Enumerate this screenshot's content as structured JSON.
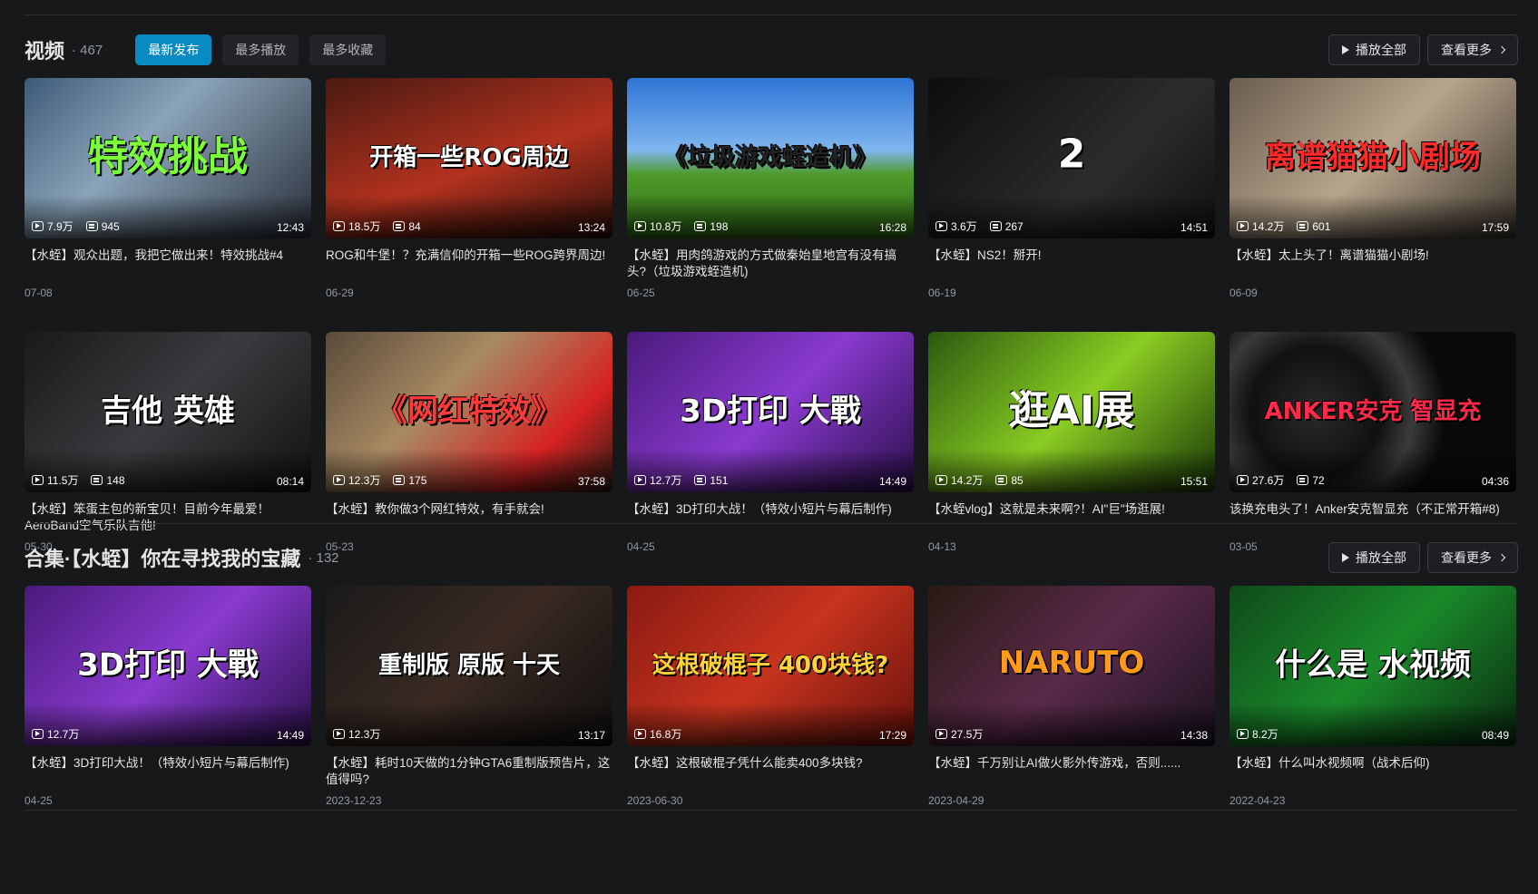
{
  "videos_section": {
    "title": "视频",
    "count": "· 467",
    "tabs": [
      "最新发布",
      "最多播放",
      "最多收藏"
    ],
    "play_all": "播放全部",
    "see_more": "查看更多",
    "items": [
      {
        "thumb_text": "特效挑战",
        "bg": "linear-gradient(135deg,#3d5a78,#8aa3b8 40%,#2a2f3a)",
        "txt_color": "#7cff3a",
        "views": "7.9万",
        "danmaku": "945",
        "duration": "12:43",
        "title": "【水蛭】观众出题，我把它做出来！特效挑战#4",
        "date": "07-08"
      },
      {
        "thumb_text": "开箱一些ROG周边",
        "bg": "linear-gradient(160deg,#4a1a12,#b3321e 55%,#2b0f0a)",
        "txt_color": "#ffffff",
        "views": "18.5万",
        "danmaku": "84",
        "duration": "13:24",
        "title": "ROG和牛堡！？充满信仰的开箱一些ROG跨界周边!",
        "date": "06-29"
      },
      {
        "thumb_text": "《垃圾游戏蛭造机》",
        "bg": "linear-gradient(180deg,#2e74d6,#7fb6ee 45%,#4f9a2a 60%,#2f6e16)",
        "txt_color": "#222222",
        "views": "10.8万",
        "danmaku": "198",
        "duration": "16:28",
        "title": "【水蛭】用肉鸽游戏的方式做秦始皇地宫有没有搞头?（垃圾游戏蛭造机)",
        "date": "06-25"
      },
      {
        "thumb_text": "2",
        "bg": "linear-gradient(135deg,#0d0d0e,#2b2c2e 60%,#111)",
        "txt_color": "#ffffff",
        "views": "3.6万",
        "danmaku": "267",
        "duration": "14:51",
        "title": "【水蛭】NS2！掰开!",
        "date": "06-19"
      },
      {
        "thumb_text": "离谱猫猫小剧场",
        "bg": "linear-gradient(135deg,#6a5d4e,#b7a58c 50%,#3a342c)",
        "txt_color": "#ff2a2a",
        "views": "14.2万",
        "danmaku": "601",
        "duration": "17:59",
        "title": "【水蛭】太上头了！离谱猫猫小剧场!",
        "date": "06-09"
      },
      {
        "thumb_text": "吉他 英雄",
        "bg": "linear-gradient(135deg,#1a1a1c,#3b3b3f 50%,#121213)",
        "txt_color": "#ffffff",
        "views": "11.5万",
        "danmaku": "148",
        "duration": "08:14",
        "title": "【水蛭】笨蛋主包的新宝贝！目前今年最爱！AeroBand空气乐队吉他!",
        "date": "05-30"
      },
      {
        "thumb_text": "《网红特效》",
        "bg": "linear-gradient(135deg,#5a4a3a,#a88a62 40%,#d62222 75%,#2a1c14)",
        "txt_color": "#ff3a3a",
        "views": "12.3万",
        "danmaku": "175",
        "duration": "37:58",
        "title": "【水蛭】教你做3个网红特效，有手就会!",
        "date": "05-23"
      },
      {
        "thumb_text": "3D打印 大戰",
        "bg": "linear-gradient(135deg,#4a1a7a,#8a3ad0 50%,#2a0f4a)",
        "txt_color": "#ffffff",
        "views": "12.7万",
        "danmaku": "151",
        "duration": "14:49",
        "title": "【水蛭】3D打印大战！（特效小短片与幕后制作)",
        "date": "04-25"
      },
      {
        "thumb_text": "逛AI展",
        "bg": "linear-gradient(135deg,#2a5a10,#8acc22 50%,#1a3a08)",
        "txt_color": "#ffffff",
        "views": "14.2万",
        "danmaku": "85",
        "duration": "15:51",
        "title": "【水蛭vlog】这就是未来啊?！AI\"巨\"场逛展!",
        "date": "04-13"
      },
      {
        "thumb_text": "ANKER安克 智显充",
        "bg": "radial-gradient(circle at 30% 50%,#2a2a2a,#111 30%,#3a3a3a 45%,#0a0a0a 60%)",
        "txt_color": "#ff2a4a",
        "views": "27.6万",
        "danmaku": "72",
        "duration": "04:36",
        "title": "该换充电头了！Anker安克智显充（不正常开箱#8)",
        "date": "03-05"
      }
    ]
  },
  "collection_section": {
    "title": "合集·【水蛭】你在寻找我的宝藏",
    "count": "· 132",
    "play_all": "播放全部",
    "see_more": "查看更多",
    "items": [
      {
        "thumb_text": "3D打印 大戰",
        "bg": "linear-gradient(135deg,#4a1a7a,#8a3ad0 50%,#2a0f4a)",
        "txt_color": "#ffffff",
        "views": "12.7万",
        "duration": "14:49",
        "title": "【水蛭】3D打印大战！（特效小短片与幕后制作)",
        "date": "04-25"
      },
      {
        "thumb_text": "重制版 原版 十天",
        "bg": "linear-gradient(135deg,#1a1a1a,#3a2a22 50%,#0f0f0f)",
        "txt_color": "#ffffff",
        "views": "12.3万",
        "duration": "13:17",
        "title": "【水蛭】耗时10天做的1分钟GTA6重制版预告片，这值得吗?",
        "date": "2023-12-23"
      },
      {
        "thumb_text": "这根破棍子 400块钱?",
        "bg": "linear-gradient(135deg,#8a1a12,#c8341e 50%,#6a120c)",
        "txt_color": "#ffd23a",
        "views": "16.8万",
        "duration": "17:29",
        "title": "【水蛭】这根破棍子凭什么能卖400多块钱?",
        "date": "2023-06-30"
      },
      {
        "thumb_text": "NARUTO",
        "bg": "linear-gradient(135deg,#2a1a12,#5a2a4a 50%,#1a1220)",
        "txt_color": "#ff9a1a",
        "views": "27.5万",
        "duration": "14:38",
        "title": "【水蛭】千万别让AI做火影外传游戏，否则......",
        "date": "2023-04-29"
      },
      {
        "thumb_text": "什么是 水视频",
        "bg": "linear-gradient(135deg,#0f4a1a,#1a8a2a 50%,#0a2a10)",
        "txt_color": "#ffffff",
        "views": "8.2万",
        "duration": "08:49",
        "title": "【水蛭】什么叫水视频啊（战术后仰)",
        "date": "2022-04-23"
      }
    ]
  }
}
